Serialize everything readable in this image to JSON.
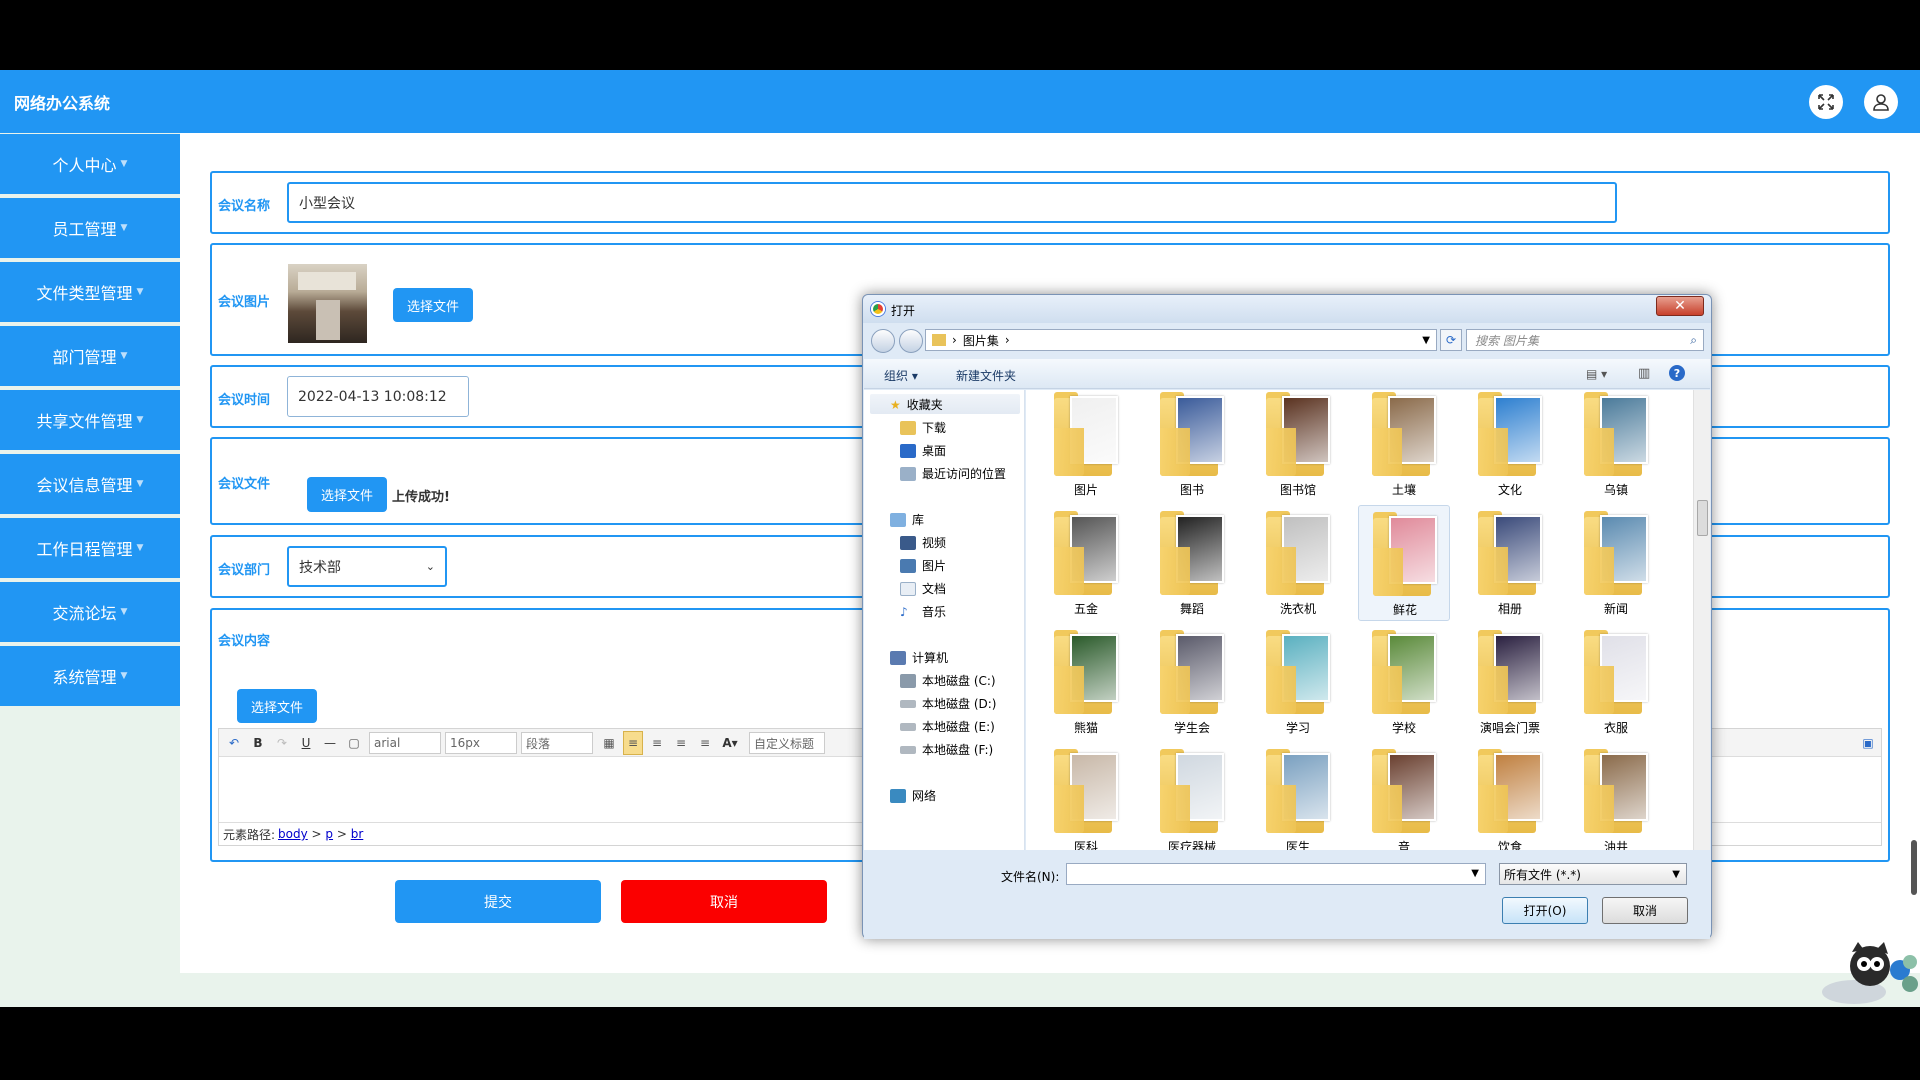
{
  "app": {
    "title": "网络办公系统"
  },
  "sidebar": {
    "items": [
      {
        "label": "个人中心"
      },
      {
        "label": "员工管理"
      },
      {
        "label": "文件类型管理"
      },
      {
        "label": "部门管理"
      },
      {
        "label": "共享文件管理"
      },
      {
        "label": "会议信息管理"
      },
      {
        "label": "工作日程管理"
      },
      {
        "label": "交流论坛"
      },
      {
        "label": "系统管理"
      }
    ]
  },
  "form": {
    "name_label": "会议名称",
    "name_value": "小型会议",
    "image_label": "会议图片",
    "choose_file": "选择文件",
    "time_label": "会议时间",
    "time_value": "2022-04-13 10:08:12",
    "file_label": "会议文件",
    "upload_status": "上传成功!",
    "dept_label": "会议部门",
    "dept_value": "技术部",
    "content_label": "会议内容",
    "editor": {
      "font": "arial",
      "size": "16px",
      "paragraph": "段落",
      "custom_title": "自定义标题",
      "path_label": "元素路径:",
      "path": [
        "body",
        "p",
        "br"
      ]
    },
    "submit": "提交",
    "cancel": "取消"
  },
  "dialog": {
    "title": "打开",
    "breadcrumb": "图片集",
    "search_placeholder": "搜索 图片集",
    "organize": "组织",
    "new_folder": "新建文件夹",
    "nav": {
      "favorites": "收藏夹",
      "downloads": "下载",
      "desktop": "桌面",
      "recent": "最近访问的位置",
      "library": "库",
      "video": "视频",
      "pictures": "图片",
      "documents": "文档",
      "music": "音乐",
      "computer": "计算机",
      "drive_c": "本地磁盘 (C:)",
      "drive_d": "本地磁盘 (D:)",
      "drive_e": "本地磁盘 (E:)",
      "drive_f": "本地磁盘 (F:)",
      "network": "网络"
    },
    "folders": [
      {
        "name": "图片",
        "color": "#f0f0f0"
      },
      {
        "name": "图书",
        "color": "#3a5b9a"
      },
      {
        "name": "图书馆",
        "color": "#5a3220"
      },
      {
        "name": "土壤",
        "color": "#8a6a4a"
      },
      {
        "name": "文化",
        "color": "#2d7fd0"
      },
      {
        "name": "乌镇",
        "color": "#4a7a9a"
      },
      {
        "name": "五金",
        "color": "#555555"
      },
      {
        "name": "舞蹈",
        "color": "#222222"
      },
      {
        "name": "洗衣机",
        "color": "#c0c0c0"
      },
      {
        "name": "鲜花",
        "color": "#e08a9a"
      },
      {
        "name": "相册",
        "color": "#3a4a7a"
      },
      {
        "name": "新闻",
        "color": "#5a8ab0"
      },
      {
        "name": "熊猫",
        "color": "#2a5a2a"
      },
      {
        "name": "学生会",
        "color": "#5a5a6a"
      },
      {
        "name": "学习",
        "color": "#5ab0c0"
      },
      {
        "name": "学校",
        "color": "#5a8a3a"
      },
      {
        "name": "演唱会门票",
        "color": "#2a2040"
      },
      {
        "name": "衣服",
        "color": "#e0e0e8"
      },
      {
        "name": "医科",
        "color": "#c8b8a8"
      },
      {
        "name": "医疗器械",
        "color": "#d0d8e0"
      },
      {
        "name": "医生",
        "color": "#7aa0c0"
      },
      {
        "name": "音",
        "color": "#6a4030"
      },
      {
        "name": "饮食",
        "color": "#c08040"
      },
      {
        "name": "油井",
        "color": "#8a6a4a"
      }
    ],
    "selected_folder": "鲜花",
    "filename_label": "文件名(N):",
    "filetype": "所有文件 (*.*)",
    "open": "打开(O)",
    "cancel": "取消"
  }
}
